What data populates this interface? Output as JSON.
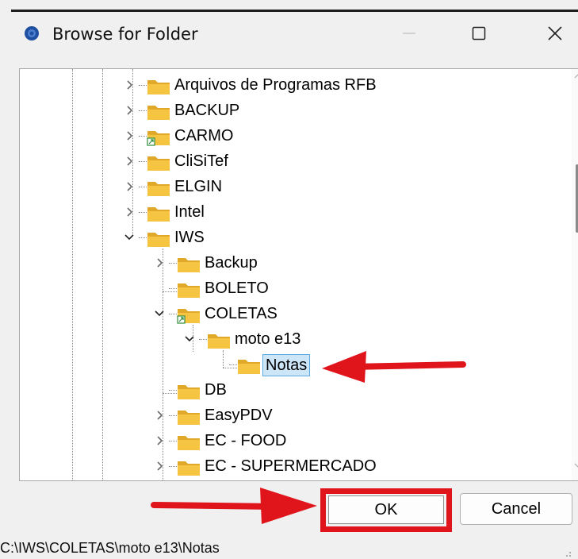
{
  "window": {
    "title": "Browse for Folder",
    "app_icon": "app-circle-icon",
    "controls": {
      "minimize": "minimize-icon",
      "maximize": "maximize-icon",
      "close": "close-icon"
    }
  },
  "tree": {
    "items": [
      {
        "label": "Arquivos de Programas RFB",
        "expander": "collapsed",
        "level": 1
      },
      {
        "label": "BACKUP",
        "expander": "collapsed",
        "level": 1
      },
      {
        "label": "CARMO",
        "expander": "collapsed",
        "level": 1,
        "badge": "shortcut-overlay"
      },
      {
        "label": "CliSiTef",
        "expander": "collapsed",
        "level": 1
      },
      {
        "label": "ELGIN",
        "expander": "collapsed",
        "level": 1
      },
      {
        "label": "Intel",
        "expander": "collapsed",
        "level": 1
      },
      {
        "label": "IWS",
        "expander": "expanded",
        "level": 1
      },
      {
        "label": "Backup",
        "expander": "collapsed",
        "level": 2
      },
      {
        "label": "BOLETO",
        "expander": "none",
        "level": 2
      },
      {
        "label": "COLETAS",
        "expander": "expanded",
        "level": 2,
        "badge": "shortcut-overlay"
      },
      {
        "label": "moto e13",
        "expander": "expanded",
        "level": 3
      },
      {
        "label": "Notas",
        "expander": "none",
        "level": 4,
        "selected": true
      },
      {
        "label": "DB",
        "expander": "none",
        "level": 2
      },
      {
        "label": "EasyPDV",
        "expander": "collapsed",
        "level": 2
      },
      {
        "label": "EC - FOOD",
        "expander": "collapsed",
        "level": 2
      },
      {
        "label": "EC - SUPERMERCADO",
        "expander": "collapsed",
        "level": 2
      }
    ]
  },
  "buttons": {
    "ok_label": "OK",
    "cancel_label": "Cancel"
  },
  "status": {
    "path": "C:\\IWS\\COLETAS\\moto e13\\Notas"
  },
  "annotations": {
    "arrow_color": "#e0151c",
    "highlight_color": "#e0151c"
  },
  "colors": {
    "folder": "#f5c542",
    "selection": "#cde6f7",
    "selection_border": "#5aa8e0"
  }
}
